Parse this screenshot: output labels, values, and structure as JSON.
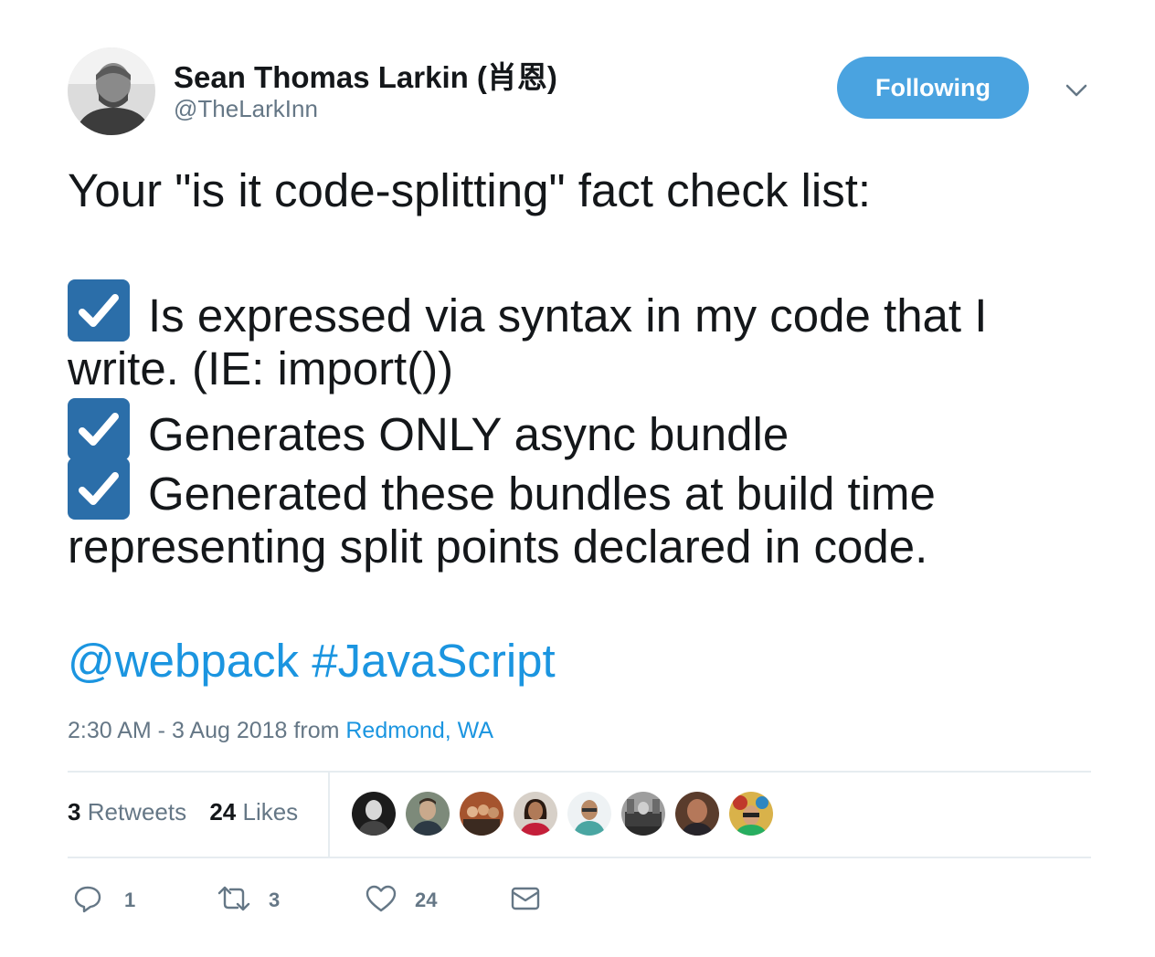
{
  "author": {
    "name": "Sean Thomas Larkin (肖恩)",
    "handle": "@TheLarkInn"
  },
  "follow_button": {
    "label": "Following"
  },
  "tweet": {
    "lines": [
      "Your \"is it code-splitting\" fact check list:",
      "Is expressed via syntax in my code that I",
      "write. (IE: import())",
      "Generates ONLY async bundle",
      "Generated these bundles at build time",
      "representing split points declared in code."
    ],
    "mention": "@webpack",
    "hashtag": "#JavaScript"
  },
  "meta": {
    "time": "2:30 AM - 3 Aug 2018",
    "from_label": "from",
    "location": "Redmond, WA"
  },
  "stats": {
    "retweets_count": "3",
    "retweets_label": "Retweets",
    "likes_count": "24",
    "likes_label": "Likes"
  },
  "actions": {
    "replies": "1",
    "retweets": "3",
    "likes": "24"
  },
  "colors": {
    "accent": "#1b95e0",
    "follow_button": "#4aa3e0",
    "checkbox": "#2b6ea9",
    "secondary_text": "#657786"
  },
  "icons": {
    "reply": "reply-icon",
    "retweet": "retweet-icon",
    "like": "heart-icon",
    "message": "envelope-icon",
    "caret": "chevron-down-icon",
    "check": "checkbox-icon"
  }
}
